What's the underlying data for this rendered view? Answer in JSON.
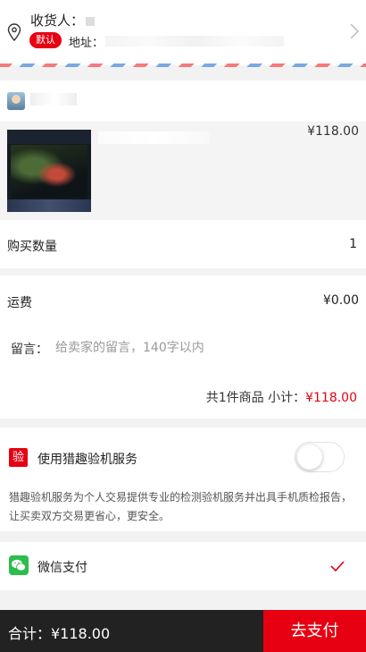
{
  "address": {
    "receiver_label": "收货人：",
    "default_badge": "默认",
    "address_label": "地址："
  },
  "product": {
    "price": "¥118.00"
  },
  "quantity": {
    "label": "购买数量",
    "value": "1"
  },
  "shipping": {
    "label": "运费",
    "value": "¥0.00"
  },
  "message": {
    "label": "留言：",
    "placeholder": "给卖家的留言，140字以内"
  },
  "summary": {
    "count_text": "共1件商品 小计：",
    "amount": "¥118.00"
  },
  "inspection": {
    "badge": "验",
    "label": "使用猎趣验机服务",
    "enabled": false,
    "description": "猎趣验机服务为个人交易提供专业的检测验机服务并出具手机质检报告，让买卖双方交易更省心，更安全。"
  },
  "payment": {
    "label": "微信支付",
    "selected": true,
    "icon": "wechat-icon"
  },
  "footer": {
    "total_text": "合计：¥118.00",
    "pay_button": "去支付"
  },
  "colors": {
    "accent": "#e60012",
    "footer_bg": "#222222",
    "wechat": "#2bbd4e"
  }
}
